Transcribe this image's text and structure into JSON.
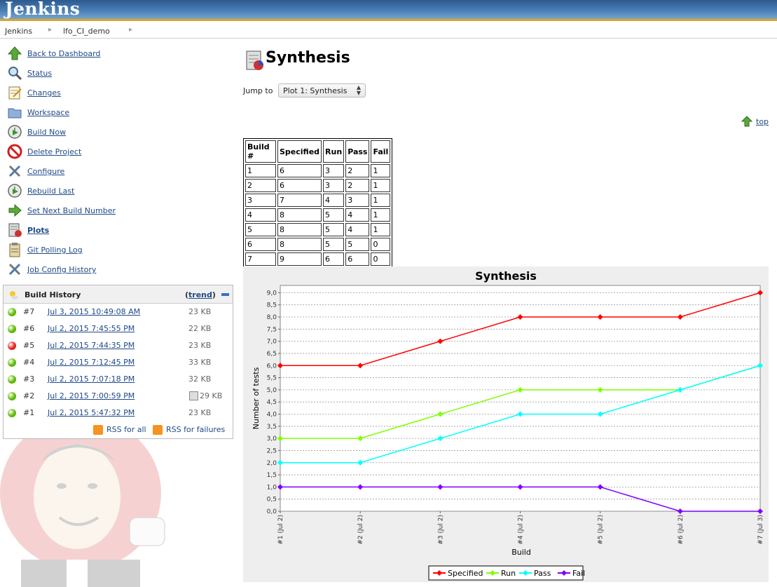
{
  "header": {
    "logo": "Jenkins"
  },
  "breadcrumb": [
    "Jenkins",
    "lfo_CI_demo"
  ],
  "tasks": [
    {
      "label": "Back to Dashboard",
      "icon": "up-arrow-icon"
    },
    {
      "label": "Status",
      "icon": "magnifier-icon"
    },
    {
      "label": "Changes",
      "icon": "notepad-icon"
    },
    {
      "label": "Workspace",
      "icon": "folder-icon"
    },
    {
      "label": "Build Now",
      "icon": "clock-play-icon"
    },
    {
      "label": "Delete Project",
      "icon": "no-entry-icon"
    },
    {
      "label": "Configure",
      "icon": "tools-icon"
    },
    {
      "label": "Rebuild Last",
      "icon": "clock-play-icon"
    },
    {
      "label": "Set Next Build Number",
      "icon": "right-arrow-icon"
    },
    {
      "label": "Plots",
      "icon": "plot-icon"
    },
    {
      "label": "Git Polling Log",
      "icon": "clipboard-icon"
    },
    {
      "label": "Job Config History",
      "icon": "tools-icon"
    }
  ],
  "build_history": {
    "title": "Build History",
    "trend_label": "trend",
    "builds": [
      {
        "num": "#7",
        "date": "Jul 3, 2015 10:49:08 AM",
        "size": "23 KB",
        "status": "success"
      },
      {
        "num": "#6",
        "date": "Jul 2, 2015 7:45:55 PM",
        "size": "22 KB",
        "status": "success"
      },
      {
        "num": "#5",
        "date": "Jul 2, 2015 7:44:35 PM",
        "size": "23 KB",
        "status": "failed"
      },
      {
        "num": "#4",
        "date": "Jul 2, 2015 7:12:45 PM",
        "size": "33 KB",
        "status": "success"
      },
      {
        "num": "#3",
        "date": "Jul 2, 2015 7:07:18 PM",
        "size": "32 KB",
        "status": "success"
      },
      {
        "num": "#2",
        "date": "Jul 2, 2015 7:00:59 PM",
        "size": "29 KB",
        "status": "success",
        "console_icon": true
      },
      {
        "num": "#1",
        "date": "Jul 2, 2015 5:47:32 PM",
        "size": "23 KB",
        "status": "success"
      }
    ],
    "rss_all": "RSS for all",
    "rss_failures": "RSS for failures"
  },
  "main": {
    "title": "Synthesis",
    "jump_label": "Jump to",
    "jump_selected": "Plot 1: Synthesis",
    "top_link": "top"
  },
  "table": {
    "headers": [
      "Build #",
      "Specified",
      "Run",
      "Pass",
      "Fail"
    ],
    "rows": [
      [
        "1",
        "6",
        "3",
        "2",
        "1"
      ],
      [
        "2",
        "6",
        "3",
        "2",
        "1"
      ],
      [
        "3",
        "7",
        "4",
        "3",
        "1"
      ],
      [
        "4",
        "8",
        "5",
        "4",
        "1"
      ],
      [
        "5",
        "8",
        "5",
        "4",
        "1"
      ],
      [
        "6",
        "8",
        "5",
        "5",
        "0"
      ],
      [
        "7",
        "9",
        "6",
        "6",
        "0"
      ]
    ]
  },
  "colors": {
    "success": "#5cb800",
    "failed": "#e02020",
    "specified": "#ff0000",
    "run": "#7fff00",
    "pass": "#00ffff",
    "fail": "#7f00ff"
  },
  "chart_data": {
    "type": "line",
    "title": "Synthesis",
    "xlabel": "Build",
    "ylabel": "Number of tests",
    "categories": [
      "#1 (Jul 2)",
      "#2 (Jul 2)",
      "#3 (Jul 2)",
      "#4 (Jul 2)",
      "#5 (Jul 2)",
      "#6 (Jul 2)",
      "#7 (Jul 3)"
    ],
    "ylim": [
      0,
      9.3
    ],
    "yticks": [
      "0,0",
      "0,5",
      "1,0",
      "1,5",
      "2,0",
      "2,5",
      "3,0",
      "3,5",
      "4,0",
      "4,5",
      "5,0",
      "5,5",
      "6,0",
      "6,5",
      "7,0",
      "7,5",
      "8,0",
      "8,5",
      "9,0"
    ],
    "grid": true,
    "legend": "bottom",
    "series": [
      {
        "name": "Specified",
        "values": [
          6,
          6,
          7,
          8,
          8,
          8,
          9
        ]
      },
      {
        "name": "Run",
        "values": [
          3,
          3,
          4,
          5,
          5,
          5,
          6
        ]
      },
      {
        "name": "Pass",
        "values": [
          2,
          2,
          3,
          4,
          4,
          5,
          6
        ]
      },
      {
        "name": "Fail",
        "values": [
          1,
          1,
          1,
          1,
          1,
          0,
          0
        ]
      }
    ]
  }
}
